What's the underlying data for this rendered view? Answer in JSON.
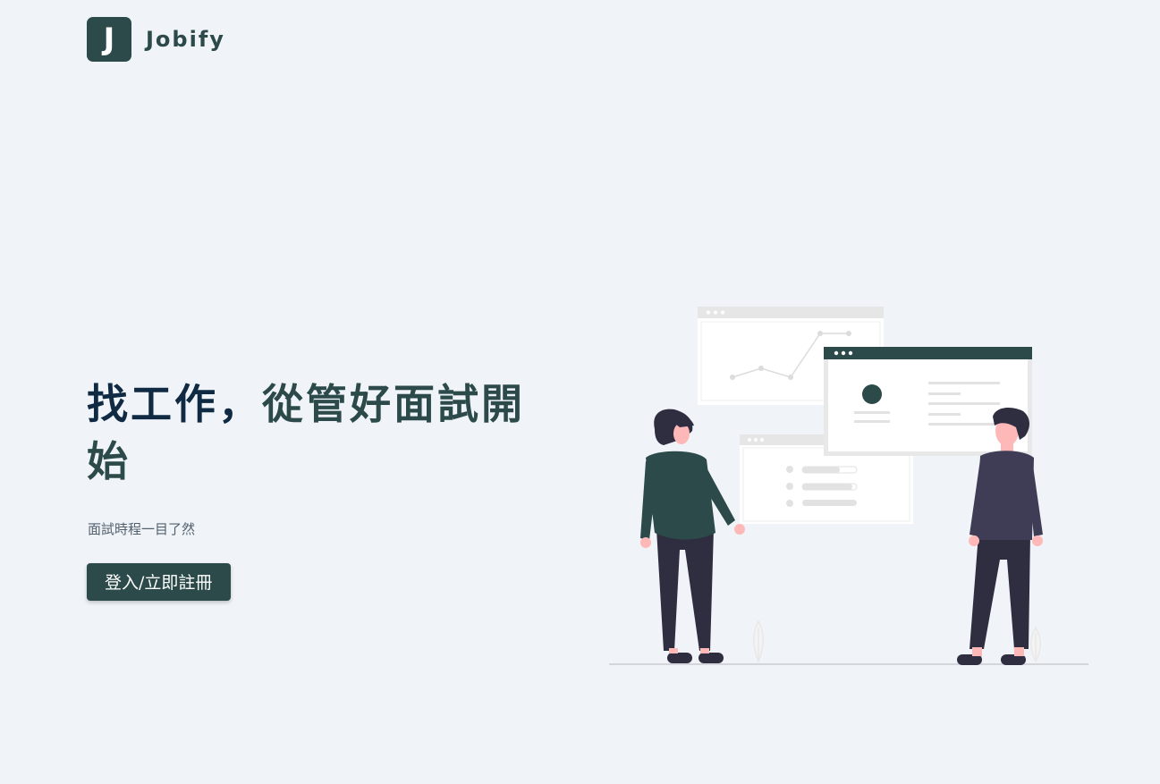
{
  "brand": {
    "logo_letter": "J",
    "name": "Jobify",
    "color": "#2c4a4a"
  },
  "hero": {
    "title_part1": "找工作，",
    "title_part2": "從管好面試開始",
    "subtitle": "面試時程一目了然",
    "cta_label": "登入/立即註冊"
  },
  "colors": {
    "background": "#f0f4f8",
    "primary": "#2c4a4a",
    "title_text": "#102a43",
    "muted_text": "#52606d"
  }
}
